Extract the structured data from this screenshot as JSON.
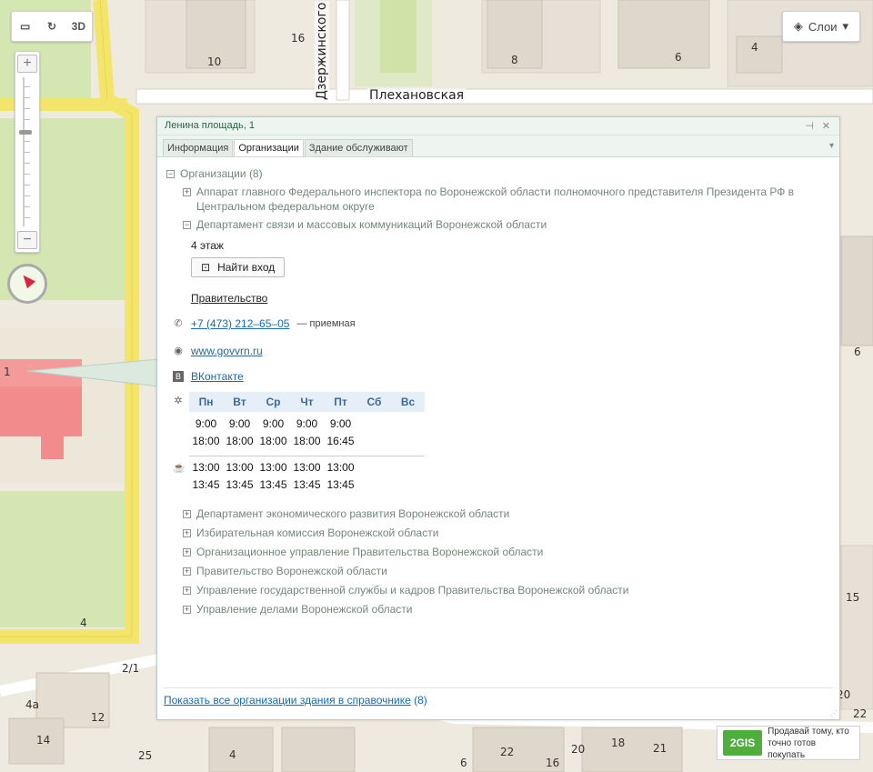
{
  "map": {
    "controls": {
      "top_label_3d": "3D",
      "layers_label": "Слои"
    },
    "streets": {
      "plekhanovskaya": "Плехановская",
      "dzerzhinskogo": "Дзержинского"
    },
    "building_numbers": [
      "16",
      "10",
      "8",
      "6",
      "4",
      "6",
      "1",
      "4",
      "2/1",
      "4a",
      "12",
      "14",
      "25",
      "4",
      "6",
      "22",
      "16",
      "20",
      "18",
      "21",
      "20",
      "22",
      "15"
    ]
  },
  "popup": {
    "address": "Ленина площадь, 1",
    "pin_icon": "pin-icon",
    "close_icon": "close-icon",
    "tabs": [
      "Информация",
      "Организации",
      "Здание обслуживают"
    ],
    "active_tab": "Организации",
    "orgs_header": "Организации",
    "orgs_count": "(8)",
    "expanded_org": {
      "title": "Департамент связи и массовых коммуникаций Воронежской области",
      "floor": "4 этаж",
      "find_entrance": "Найти вход",
      "parent": "Правительство",
      "phone": "+7 (473) 212–65–05",
      "phone_note": "— приемная",
      "website": "www.govvrn.ru",
      "social": "ВКонтакте",
      "schedule": {
        "days": [
          "Пн",
          "Вт",
          "Ср",
          "Чт",
          "Пт",
          "Сб",
          "Вс"
        ],
        "open": [
          "9:00",
          "9:00",
          "9:00",
          "9:00",
          "9:00",
          "",
          ""
        ],
        "close": [
          "18:00",
          "18:00",
          "18:00",
          "18:00",
          "16:45",
          "",
          ""
        ],
        "break_start": [
          "13:00",
          "13:00",
          "13:00",
          "13:00",
          "13:00",
          "",
          ""
        ],
        "break_end": [
          "13:45",
          "13:45",
          "13:45",
          "13:45",
          "13:45",
          "",
          ""
        ]
      }
    },
    "org_before": "Аппарат главного Федерального инспектора по Воронежской области полномочного представителя Президента РФ в Центральном федеральном округе",
    "org_list": [
      "Департамент экономического развития Воронежской области",
      "Избирательная комиссия Воронежской области",
      "Организационное управление Правительства Воронежской области",
      "Правительство Воронежской области",
      "Управление государственной службы и кадров Правительства Воронежской области",
      "Управление делами Воронежской области"
    ],
    "footer_link": "Показать все организации здания в справочнике",
    "footer_count": "(8)"
  },
  "promo": {
    "logo": "2GIS",
    "line1": "Продавай тому, кто",
    "line2": "точно готов покупать"
  }
}
